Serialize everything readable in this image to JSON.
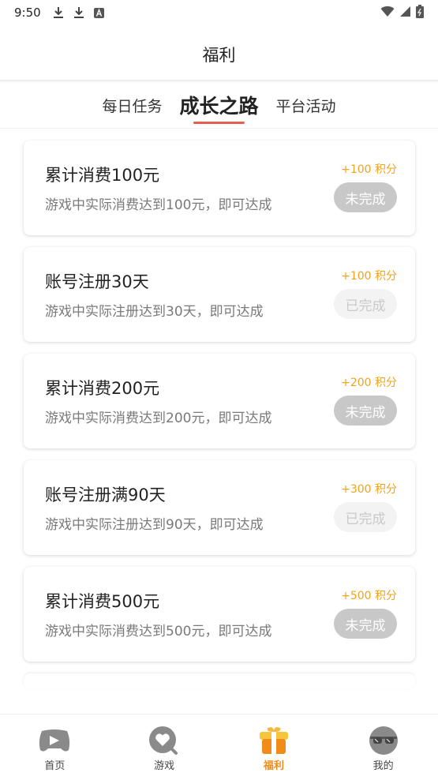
{
  "status_bar": {
    "time": "9:50",
    "icons": [
      "download-icon",
      "download-icon",
      "a-badge-icon",
      "wifi-icon",
      "signal-icon",
      "battery-icon"
    ]
  },
  "header": {
    "title": "福利"
  },
  "tabs": [
    {
      "label": "每日任务",
      "active": false
    },
    {
      "label": "成长之路",
      "active": true
    },
    {
      "label": "平台活动",
      "active": false
    }
  ],
  "tasks": [
    {
      "title": "累计消费100元",
      "desc": "游戏中实际消费达到100元，即可达成",
      "points": "+100 积分",
      "status": "未完成",
      "done": false
    },
    {
      "title": "账号注册30天",
      "desc": "游戏中实际注册达到30天，即可达成",
      "points": "+100 积分",
      "status": "已完成",
      "done": true
    },
    {
      "title": "累计消费200元",
      "desc": "游戏中实际消费达到200元，即可达成",
      "points": "+200 积分",
      "status": "未完成",
      "done": false
    },
    {
      "title": "账号注册满90天",
      "desc": "游戏中实际注册达到90天，即可达成",
      "points": "+300 积分",
      "status": "已完成",
      "done": true
    },
    {
      "title": "累计消费500元",
      "desc": "游戏中实际消费达到500元，即可达成",
      "points": "+500 积分",
      "status": "未完成",
      "done": false
    }
  ],
  "bottom_nav": [
    {
      "label": "首页",
      "icon": "gamepad-icon",
      "active": false
    },
    {
      "label": "游戏",
      "icon": "heart-search-icon",
      "active": false
    },
    {
      "label": "福利",
      "icon": "gift-icon",
      "active": true
    },
    {
      "label": "我的",
      "icon": "sunglasses-avatar-icon",
      "active": false
    }
  ],
  "colors": {
    "accent_orange": "#f08c1a",
    "points_orange": "#f0a31e",
    "tab_underline": "#e4604e",
    "undone_button": "#c8c8c8",
    "done_button": "#f3f3f3"
  }
}
